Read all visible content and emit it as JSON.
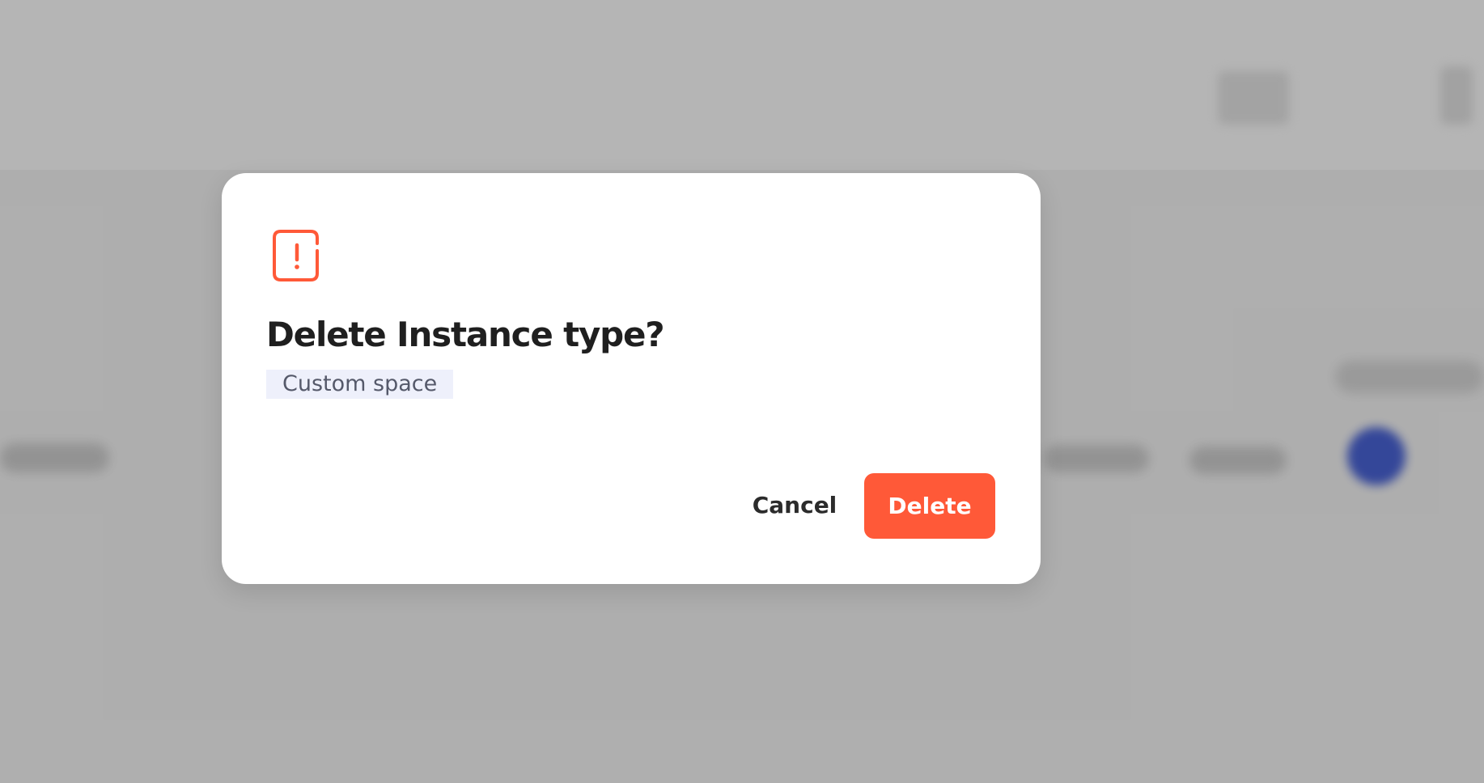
{
  "dialog": {
    "icon": "alert-square-icon",
    "title": "Delete Instance type?",
    "item_name": "Custom space",
    "cancel_label": "Cancel",
    "delete_label": "Delete"
  },
  "colors": {
    "accent_danger": "#ff5938",
    "title_text": "#1f1f1f",
    "tag_background": "#eef0fb",
    "overlay": "rgba(0,0,0,0.29)"
  }
}
